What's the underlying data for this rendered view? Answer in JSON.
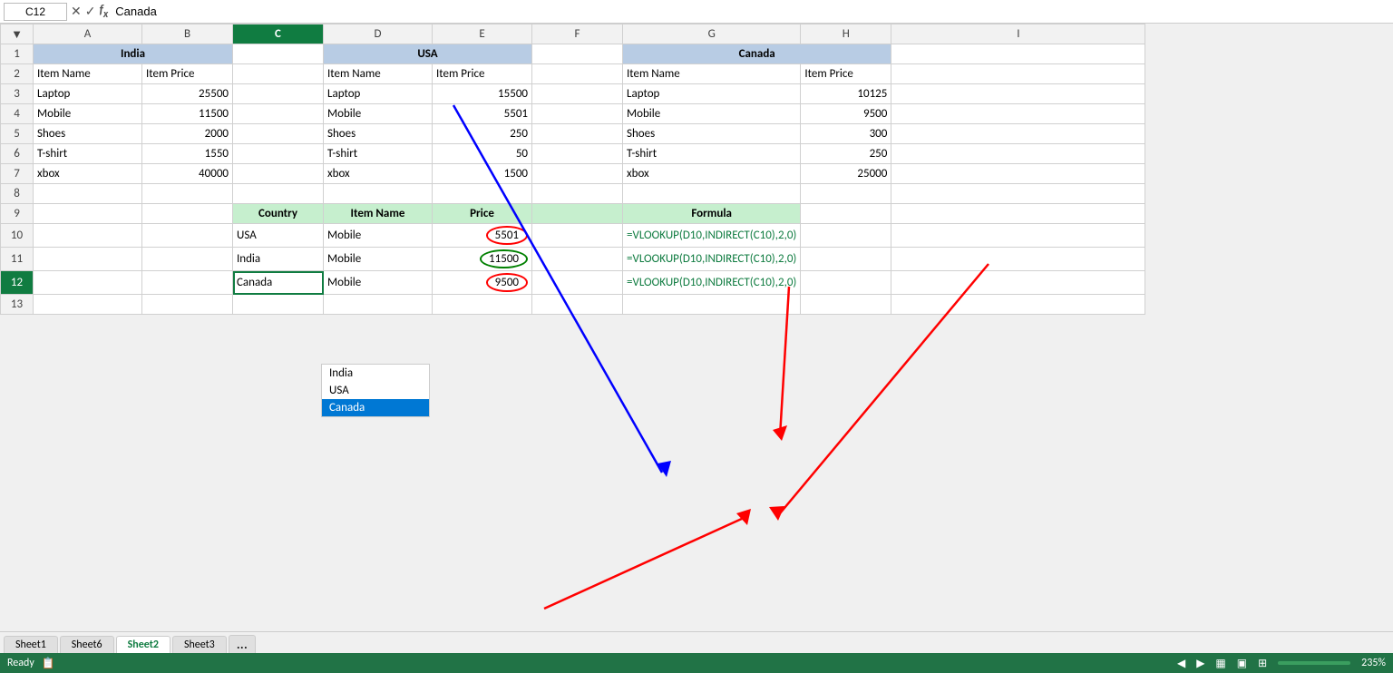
{
  "nameBox": "C12",
  "formulaContent": "Canada",
  "columns": [
    "",
    "A",
    "B",
    "C",
    "D",
    "E",
    "F",
    "G",
    "H",
    "I"
  ],
  "status": "Ready",
  "zoom": "235%",
  "sheets": [
    "Sheet1",
    "Sheet6",
    "Sheet2",
    "Sheet3"
  ],
  "activeSheet": "Sheet2",
  "india": {
    "header": "India",
    "col1": "Item Name",
    "col2": "Item Price",
    "rows": [
      {
        "name": "Laptop",
        "price": "25500"
      },
      {
        "name": "Mobile",
        "price": "11500"
      },
      {
        "name": "Shoes",
        "price": "2000"
      },
      {
        "name": "T-shirt",
        "price": "1550"
      },
      {
        "name": "xbox",
        "price": "40000"
      }
    ]
  },
  "usa": {
    "header": "USA",
    "col1": "Item Name",
    "col2": "Item Price",
    "rows": [
      {
        "name": "Laptop",
        "price": "15500"
      },
      {
        "name": "Mobile",
        "price": "5501"
      },
      {
        "name": "Shoes",
        "price": "250"
      },
      {
        "name": "T-shirt",
        "price": "50"
      },
      {
        "name": "xbox",
        "price": "1500"
      }
    ]
  },
  "canada": {
    "header": "Canada",
    "col1": "Item Name",
    "col2": "Item Price",
    "rows": [
      {
        "name": "Laptop",
        "price": "10125"
      },
      {
        "name": "Mobile",
        "price": "9500"
      },
      {
        "name": "Shoes",
        "price": "300"
      },
      {
        "name": "T-shirt",
        "price": "250"
      },
      {
        "name": "xbox",
        "price": "25000"
      }
    ]
  },
  "lookup": {
    "headers": [
      "Country",
      "Item Name",
      "Price",
      "",
      "Formula"
    ],
    "rows": [
      {
        "country": "USA",
        "item": "Mobile",
        "price": "5501",
        "circleColor": "red",
        "formula": "=VLOOKUP(D10,INDIRECT(C10),2,0)"
      },
      {
        "country": "India",
        "item": "Mobile",
        "price": "11500",
        "circleColor": "green",
        "formula": "=VLOOKUP(D10,INDIRECT(C10),2,0)"
      },
      {
        "country": "Canada",
        "item": "Mobile",
        "price": "9500",
        "circleColor": "red",
        "formula": "=VLOOKUP(D10,INDIRECT(C10),2,0)"
      }
    ]
  },
  "dropdown": {
    "options": [
      "India",
      "USA",
      "Canada"
    ],
    "selected": "Canada"
  }
}
